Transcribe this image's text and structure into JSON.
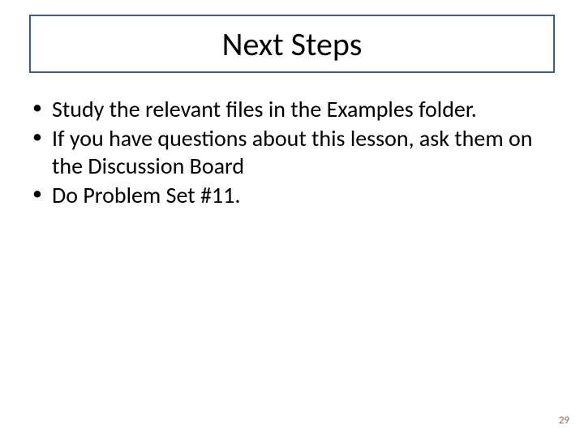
{
  "slide": {
    "title": "Next Steps",
    "bullets": [
      "Study the relevant files in the Examples folder.",
      "If you have questions about this lesson, ask them on the Discussion Board",
      "Do Problem Set #11."
    ],
    "page_number": "29"
  }
}
